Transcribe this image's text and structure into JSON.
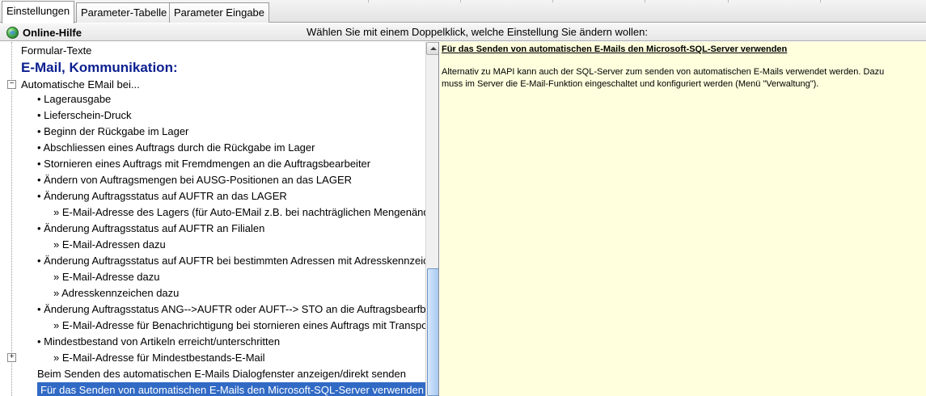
{
  "tabs": [
    {
      "label": "Einstellungen",
      "active": true
    },
    {
      "label": "Parameter-Tabelle",
      "active": false
    },
    {
      "label": "Parameter Eingabe",
      "active": false
    }
  ],
  "infobar": {
    "help_label": "Online-Hilfe",
    "hint": "Wählen Sie mit einem Doppelklick, welche Einstellung Sie ändern wollen:"
  },
  "tree": {
    "items": [
      {
        "label": "Formular-Texte",
        "type": "item"
      },
      {
        "label": "E-Mail, Kommunikation:",
        "type": "heading"
      },
      {
        "label": "Automatische EMail bei...",
        "type": "group",
        "expander": "−"
      },
      {
        "label": "• Lagerausgabe",
        "type": "child"
      },
      {
        "label": "• Lieferschein-Druck",
        "type": "child"
      },
      {
        "label": "• Beginn der Rückgabe im Lager",
        "type": "child"
      },
      {
        "label": "• Abschliessen eines Auftrags durch die Rückgabe im Lager",
        "type": "child"
      },
      {
        "label": "• Stornieren eines Auftrags mit Fremdmengen an die Auftragsbearbeiter",
        "type": "child"
      },
      {
        "label": "• Ändern von Auftragsmengen bei AUSG-Positionen an das LAGER",
        "type": "child"
      },
      {
        "label": "• Änderung Auftragsstatus auf AUFTR an das LAGER",
        "type": "child"
      },
      {
        "label": "» E-Mail-Adresse des Lagers (für Auto-EMail z.B. bei nachträglichen Mengenänd",
        "type": "grandchild"
      },
      {
        "label": "• Änderung Auftragsstatus auf AUFTR an Filialen",
        "type": "child"
      },
      {
        "label": "» E-Mail-Adressen  dazu",
        "type": "grandchild"
      },
      {
        "label": "• Änderung Auftragsstatus auf AUFTR bei bestimmten Adressen mit Adresskennzeic",
        "type": "child"
      },
      {
        "label": "» E-Mail-Adresse  dazu",
        "type": "grandchild"
      },
      {
        "label": "» Adresskennzeichen dazu",
        "type": "grandchild"
      },
      {
        "label": "• Änderung Auftragsstatus ANG-->AUFTR oder AUFT--> STO an die Auftragsbearfbe",
        "type": "child"
      },
      {
        "label": "» E-Mail-Adresse für Benachrichtigung bei stornieren eines Auftrags mit Transpo",
        "type": "grandchild"
      },
      {
        "label": "• Mindestbestand von Artikeln erreicht/unterschritten",
        "type": "child"
      },
      {
        "label": "» E-Mail-Adresse für Mindestbestands-E-Mail",
        "type": "grandchild",
        "expander": "+"
      },
      {
        "label": "Beim Senden des automatischen E-Mails Dialogfenster anzeigen/direkt senden",
        "type": "sub"
      },
      {
        "label": "Für das Senden von automatischen E-Mails den Microsoft-SQL-Server verwenden",
        "type": "sub",
        "selected": true
      }
    ]
  },
  "description": {
    "title": "Für das Senden von automatischen E-Mails den Microsoft-SQL-Server verwenden",
    "body": "Alternativ zu MAPI kann auch der SQL-Server zum senden von automatischen E-Mails verwendet werden. Dazu\nmuss im Server die E-Mail-Funktion eingeschaltet und konfiguriert werden (Menü \"Verwaltung\")."
  },
  "colors": {
    "heading": "#0b1f8f",
    "selection": "#316ac5",
    "description_background": "#ffffdd"
  }
}
